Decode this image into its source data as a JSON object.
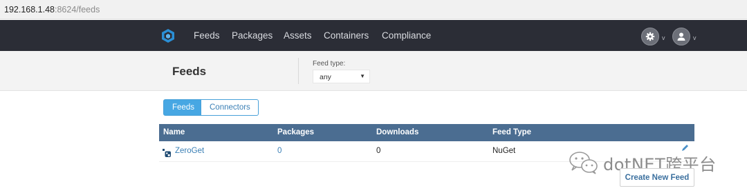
{
  "browser": {
    "url_host": "192.168.1.48",
    "url_rest": ":8624/feeds"
  },
  "nav": {
    "items": [
      "Feeds",
      "Packages",
      "Assets",
      "Containers",
      "Compliance"
    ],
    "caret": "v"
  },
  "page": {
    "title": "Feeds",
    "feed_type_label": "Feed type:",
    "feed_type_value": "any",
    "select_arrow": "▼"
  },
  "tabs": [
    "Feeds",
    "Connectors"
  ],
  "table": {
    "headers": [
      "Name",
      "Packages",
      "Downloads",
      "Feed Type"
    ],
    "rows": [
      {
        "name": "ZeroGet",
        "packages": "0",
        "downloads": "0",
        "feed_type": "NuGet"
      }
    ]
  },
  "actions": {
    "create_label": "Create New Feed"
  },
  "watermark": {
    "text": "dotNET跨平台"
  },
  "colors": {
    "navbar": "#2b2d36",
    "accent": "#47a7e3",
    "table_header": "#4b6d91",
    "link": "#3a7fb5"
  }
}
